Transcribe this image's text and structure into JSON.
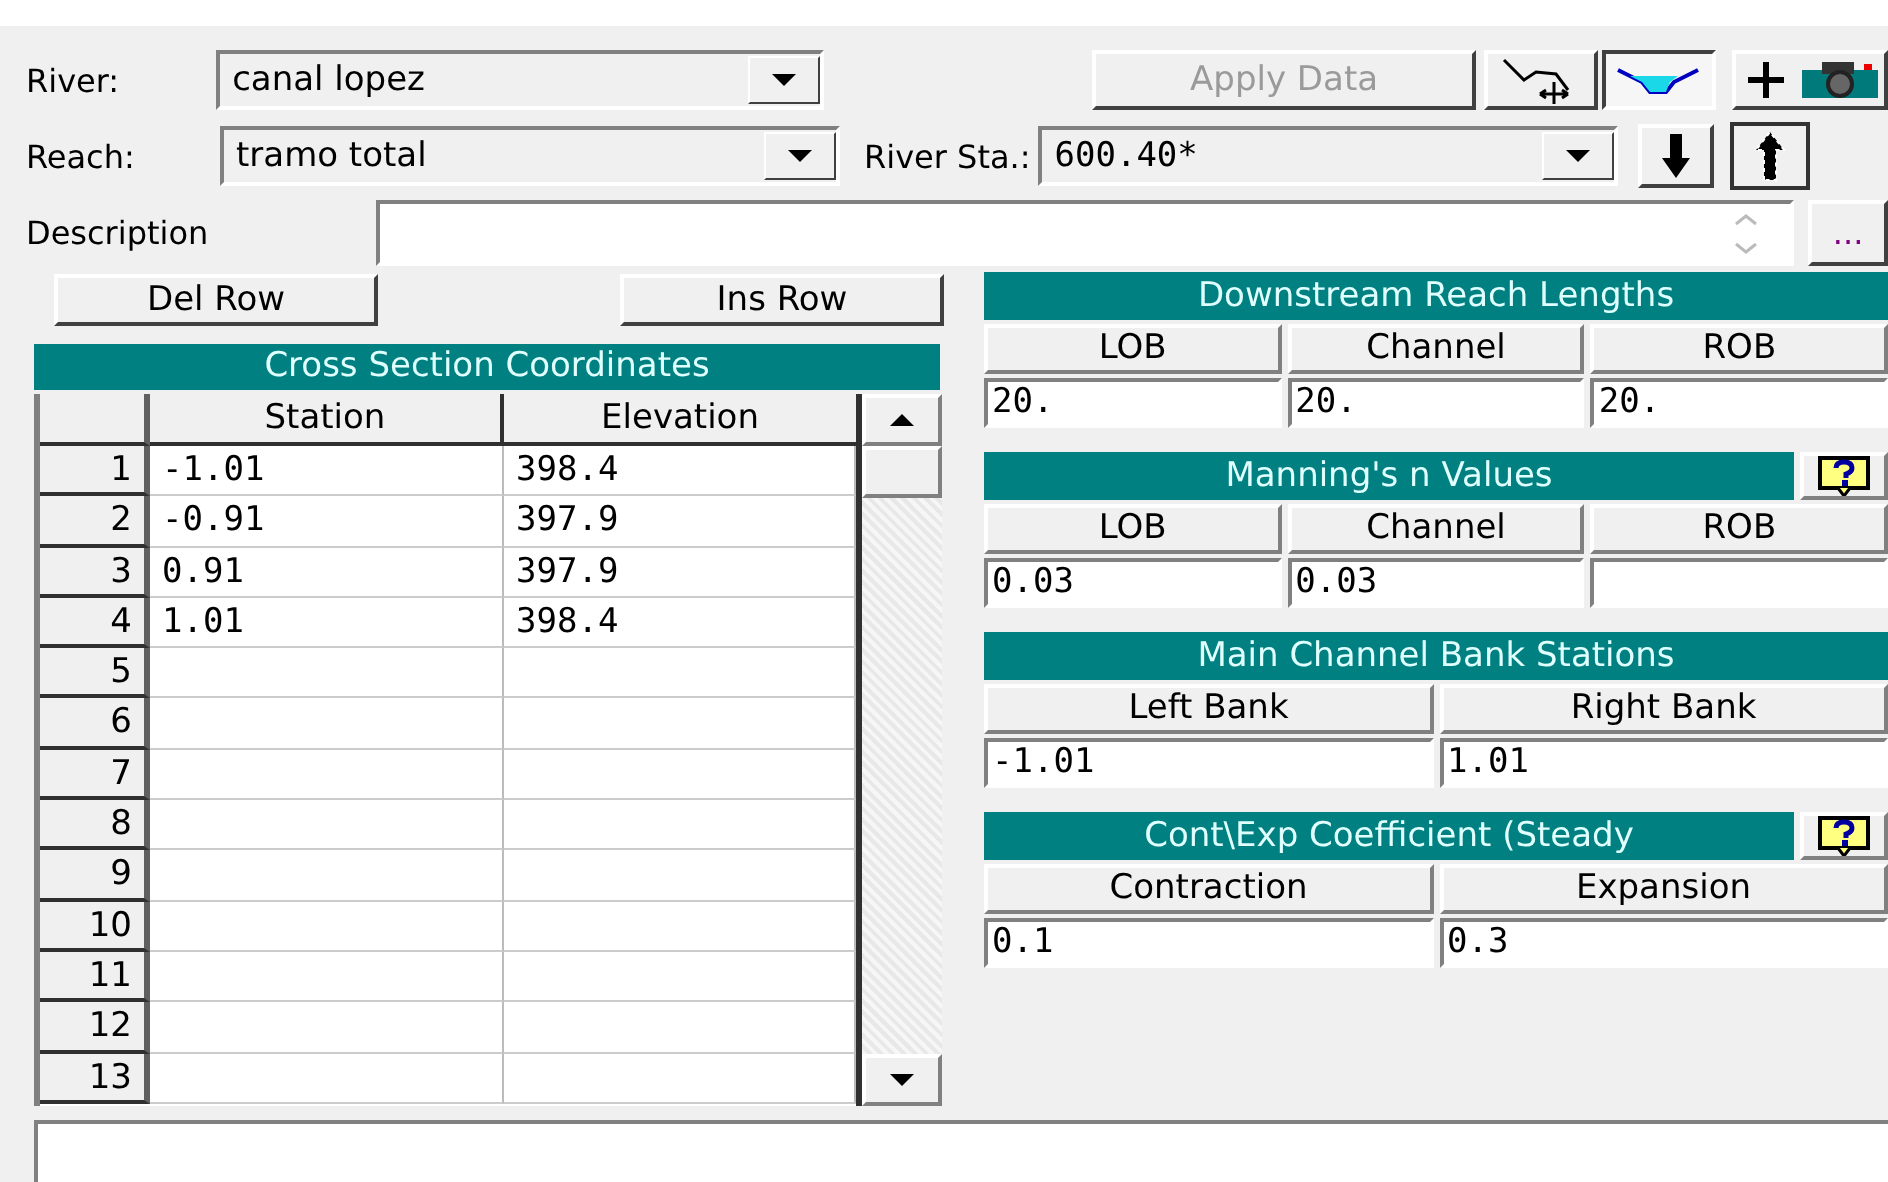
{
  "river": {
    "label": "River:",
    "value": "canal lopez"
  },
  "reach": {
    "label": "Reach:",
    "value": "tramo total"
  },
  "river_station": {
    "label": "River Sta.:",
    "value": "600.40*"
  },
  "apply_button": {
    "label": "Apply Data",
    "disabled": true
  },
  "description": {
    "label": "Description"
  },
  "more_button": "...",
  "del_row_button": "Del Row",
  "ins_row_button": "Ins Row",
  "cross_section": {
    "title": "Cross Section Coordinates",
    "columns": [
      "Station",
      "Elevation"
    ],
    "rows": [
      {
        "number": "1",
        "station": "-1.01",
        "elevation": "398.4"
      },
      {
        "number": "2",
        "station": "-0.91",
        "elevation": "397.9"
      },
      {
        "number": "3",
        "station": "0.91",
        "elevation": "397.9"
      },
      {
        "number": "4",
        "station": "1.01",
        "elevation": "398.4"
      },
      {
        "number": "5"
      },
      {
        "number": "6"
      },
      {
        "number": "7"
      },
      {
        "number": "8"
      },
      {
        "number": "9"
      },
      {
        "number": "10"
      },
      {
        "number": "11"
      },
      {
        "number": "12"
      },
      {
        "number": "13"
      }
    ]
  },
  "panels": [
    {
      "title": "Downstream Reach Lengths",
      "help": false,
      "columns": [
        "LOB",
        "Channel",
        "ROB"
      ],
      "values": [
        "20.",
        "20.",
        "20."
      ]
    },
    {
      "title": "Manning's n Values",
      "help": true,
      "columns": [
        "LOB",
        "Channel",
        "ROB"
      ],
      "values": [
        "0.03",
        "0.03"
      ]
    },
    {
      "title": "Main Channel Bank Stations",
      "help": false,
      "columns": [
        "Left Bank",
        "Right Bank"
      ],
      "values": [
        "-1.01",
        "1.01"
      ]
    },
    {
      "title": "Cont\\Exp Coefficient (Steady",
      "help": true,
      "columns": [
        "Contraction",
        "Expansion"
      ],
      "values": [
        "0.1",
        "0.3"
      ]
    }
  ]
}
